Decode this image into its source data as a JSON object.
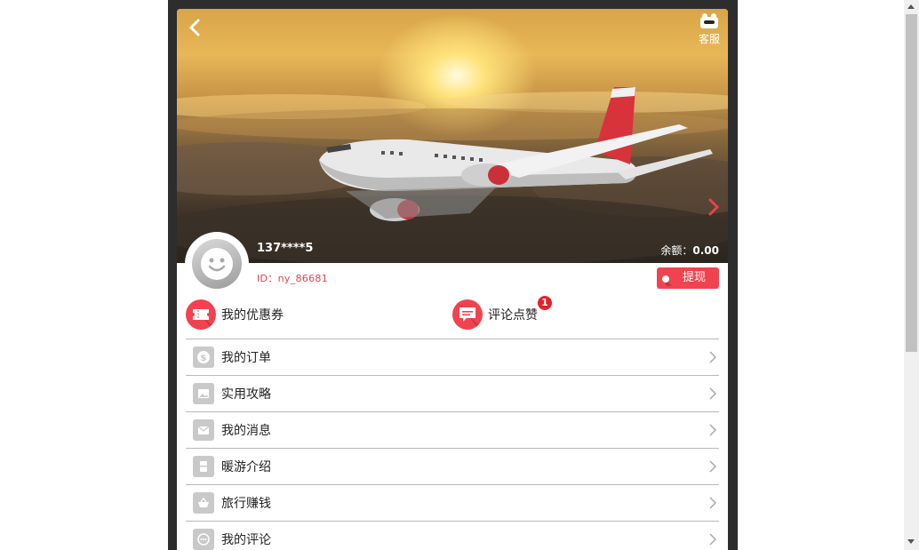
{
  "header": {
    "back_icon": "chevron-left-icon",
    "customer_service_label": "客服",
    "customer_service_icon": "service-icon",
    "next_icon": "chevron-right-icon"
  },
  "profile": {
    "username": "137****5",
    "balance_label": "余额：",
    "balance_value": "0.00",
    "user_id": "ID：ny_86681",
    "withdraw_label": "提现"
  },
  "quick_links": [
    {
      "label": "我的优惠券",
      "icon": "ticket-icon"
    },
    {
      "label": "评论点赞",
      "icon": "comment-icon",
      "badge": "1"
    }
  ],
  "menu": [
    {
      "label": "我的订单",
      "icon": "dollar-icon"
    },
    {
      "label": "实用攻略",
      "icon": "image-icon"
    },
    {
      "label": "我的消息",
      "icon": "mail-icon"
    },
    {
      "label": "暖游介绍",
      "icon": "card-icon"
    },
    {
      "label": "旅行赚钱",
      "icon": "basket-icon"
    },
    {
      "label": "我的评论",
      "icon": "chat-icon"
    }
  ],
  "colors": {
    "accent": "#f0434f",
    "frame": "#2d2d2d",
    "divider": "#b9b9b9",
    "icon_gray": "#c9c9c9"
  }
}
